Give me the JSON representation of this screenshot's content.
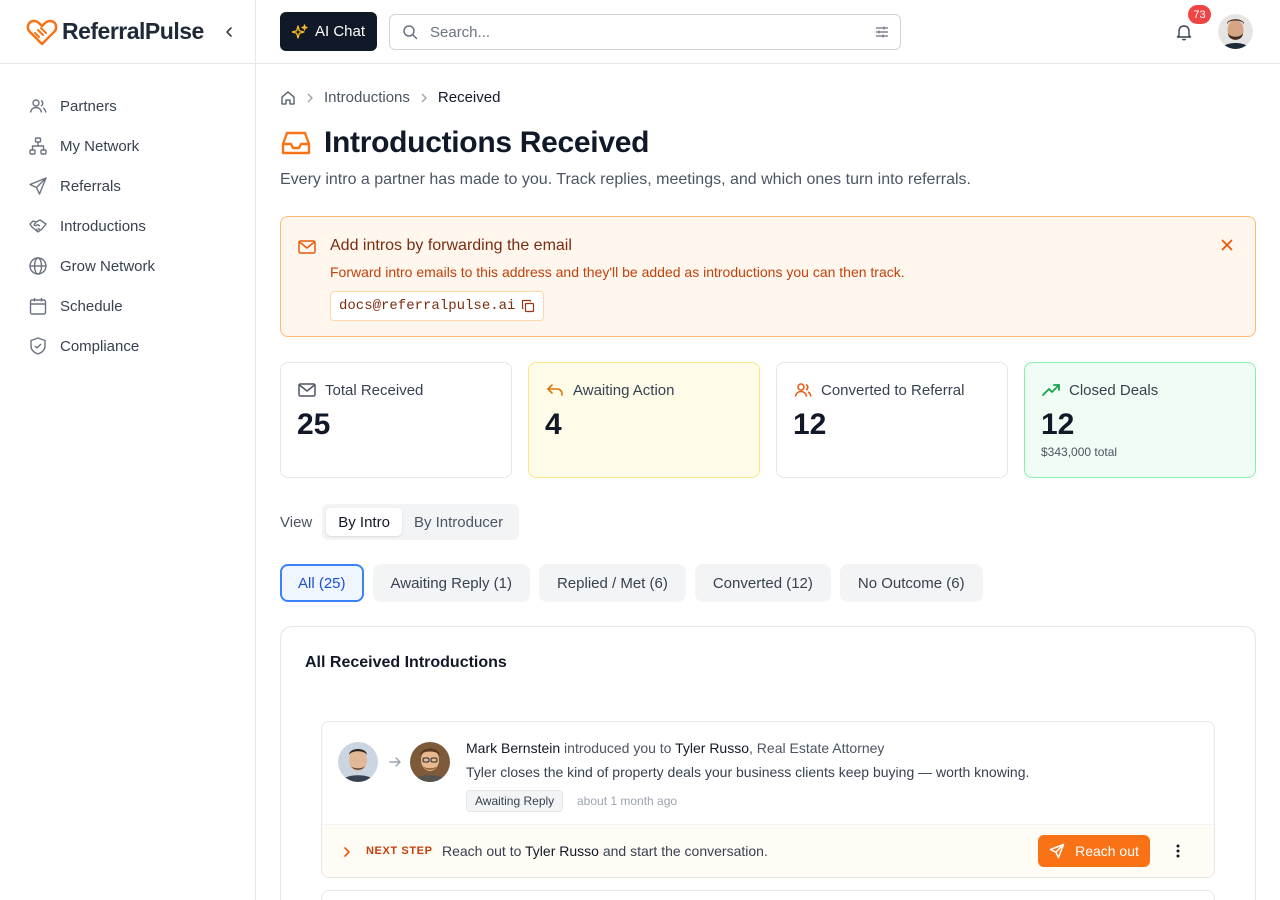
{
  "brand": {
    "name": "ReferralPulse"
  },
  "sidebar": {
    "items": [
      {
        "label": "Partners",
        "icon": "users-icon"
      },
      {
        "label": "My Network",
        "icon": "network-icon"
      },
      {
        "label": "Referrals",
        "icon": "send-icon"
      },
      {
        "label": "Introductions",
        "icon": "handshake-icon"
      },
      {
        "label": "Grow Network",
        "icon": "globe-icon"
      },
      {
        "label": "Schedule",
        "icon": "calendar-icon"
      },
      {
        "label": "Compliance",
        "icon": "shield-icon"
      }
    ]
  },
  "header": {
    "ai_chat_label": "AI Chat",
    "search_placeholder": "Search...",
    "notification_count": "73"
  },
  "breadcrumb": {
    "parent": "Introductions",
    "current": "Received"
  },
  "page": {
    "title": "Introductions Received",
    "subtitle": "Every intro a partner has made to you. Track replies, meetings, and which ones turn into referrals."
  },
  "banner": {
    "title": "Add intros by forwarding the email",
    "text": "Forward intro emails to this address and they'll be added as introductions you can then track.",
    "email": "docs@referralpulse.ai"
  },
  "stats": [
    {
      "label": "Total Received",
      "value": "25",
      "sub": "",
      "icon": "mail-icon"
    },
    {
      "label": "Awaiting Action",
      "value": "4",
      "sub": "",
      "icon": "reply-icon"
    },
    {
      "label": "Converted to Referral",
      "value": "12",
      "sub": "",
      "icon": "users-icon"
    },
    {
      "label": "Closed Deals",
      "value": "12",
      "sub": "$343,000 total",
      "icon": "trending-up-icon"
    }
  ],
  "view": {
    "label": "View",
    "options": [
      "By Intro",
      "By Introducer"
    ],
    "selected": "By Intro"
  },
  "filters": [
    "All (25)",
    "Awaiting Reply (1)",
    "Replied / Met (6)",
    "Converted (12)",
    "No Outcome (6)"
  ],
  "list": {
    "title": "All Received Introductions",
    "items": [
      {
        "introducer": "Mark Bernstein",
        "connector": "introduced you to",
        "contact": "Tyler Russo",
        "contact_role": ", Real Estate Attorney",
        "description": "Tyler closes the kind of property deals your business clients keep buying — worth knowing.",
        "status": "Awaiting Reply",
        "time": "about 1 month ago",
        "next_step_label": "NEXT STEP",
        "next_step_prefix": "Reach out to",
        "next_step_name": "Tyler Russo",
        "next_step_suffix": "and start the conversation.",
        "action_label": "Reach out"
      }
    ]
  },
  "colors": {
    "accent": "#f97316",
    "primary_dark": "#111827",
    "link_blue": "#3b82f6",
    "success": "#22c55e",
    "danger": "#ef4444"
  }
}
